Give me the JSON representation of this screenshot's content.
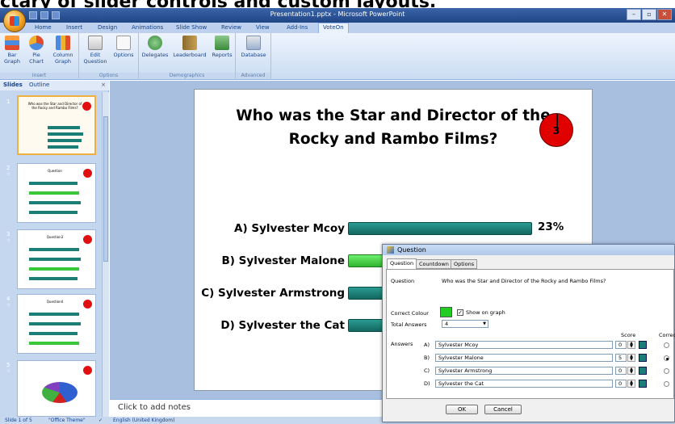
{
  "caption": "ctary of slider controls and custom layouts.",
  "window": {
    "title": "Presentation1.pptx - Microsoft PowerPoint",
    "controls": [
      "–",
      "▫",
      "✕"
    ]
  },
  "ribbon": {
    "tabs": [
      "Home",
      "Insert",
      "Design",
      "Animations",
      "Slide Show",
      "Review",
      "View",
      "Add-Ins",
      "VoteOn"
    ],
    "active_tab": "VoteOn",
    "groups": [
      {
        "label": "Insert",
        "buttons": [
          "Bar Graph",
          "Pie Chart",
          "Column Graph"
        ]
      },
      {
        "label": "Options",
        "buttons": [
          "Edit Question",
          "Options"
        ]
      },
      {
        "label": "Demographics",
        "buttons": [
          "Delegates",
          "Leaderboard",
          "Reports"
        ]
      },
      {
        "label": "Advanced",
        "buttons": [
          "Database"
        ]
      }
    ]
  },
  "left_pane": {
    "tabs": [
      "Slides",
      "Outline"
    ],
    "close": "×",
    "slides": [
      {
        "num": "1",
        "title": "Who was the Star and Director of the Rocky and Rambo Films?"
      },
      {
        "num": "2",
        "title": "Question"
      },
      {
        "num": "3",
        "title": "Question3"
      },
      {
        "num": "4",
        "title": "Question4"
      },
      {
        "num": "5",
        "title": ""
      }
    ]
  },
  "slide": {
    "title": "Who was the Star and Director of the Rocky and Rambo Films?",
    "counter": "3",
    "answers": [
      {
        "label": "A) Sylvester Mcoy",
        "percent": "23%",
        "value": 23,
        "correct": false
      },
      {
        "label": "B) Sylvester Malone",
        "percent": "",
        "value": 0,
        "correct": true
      },
      {
        "label": "C) Sylvester Armstrong",
        "percent": "",
        "value": 0,
        "correct": false
      },
      {
        "label": "D) Sylvester the Cat",
        "percent": "",
        "value": 0,
        "correct": false
      }
    ]
  },
  "notes_placeholder": "Click to add notes",
  "status": {
    "slide": "Slide 1 of 5",
    "theme": "\"Office Theme\"",
    "language": "English (United Kingdom)"
  },
  "dialog": {
    "title": "Question",
    "tabs": [
      "Question",
      "Countdown",
      "Options"
    ],
    "question_label": "Question",
    "question_text": "Who was the Star and Director of the Rocky and Rambo Films?",
    "correct_colour_label": "Correct Colour",
    "correct_colour": "#22cc22",
    "show_on_graph": "Show on graph",
    "total_answers_label": "Total Answers",
    "total_answers": "4",
    "score_header": "Score",
    "correct_header": "Correc",
    "answers_label": "Answers",
    "answers": [
      {
        "key": "A)",
        "text": "Sylvester Mcoy",
        "score": "0",
        "correct": false
      },
      {
        "key": "B)",
        "text": "Sylvester Malone",
        "score": "5",
        "correct": true
      },
      {
        "key": "C)",
        "text": "Sylvester Armstrong",
        "score": "0",
        "correct": false
      },
      {
        "key": "D)",
        "text": "Sylvester the Cat",
        "score": "0",
        "correct": false
      }
    ],
    "ok": "OK",
    "cancel": "Cancel"
  },
  "colors": {
    "bar": "#1c7f77",
    "correct": "#38c838",
    "counter": "#e00000"
  }
}
